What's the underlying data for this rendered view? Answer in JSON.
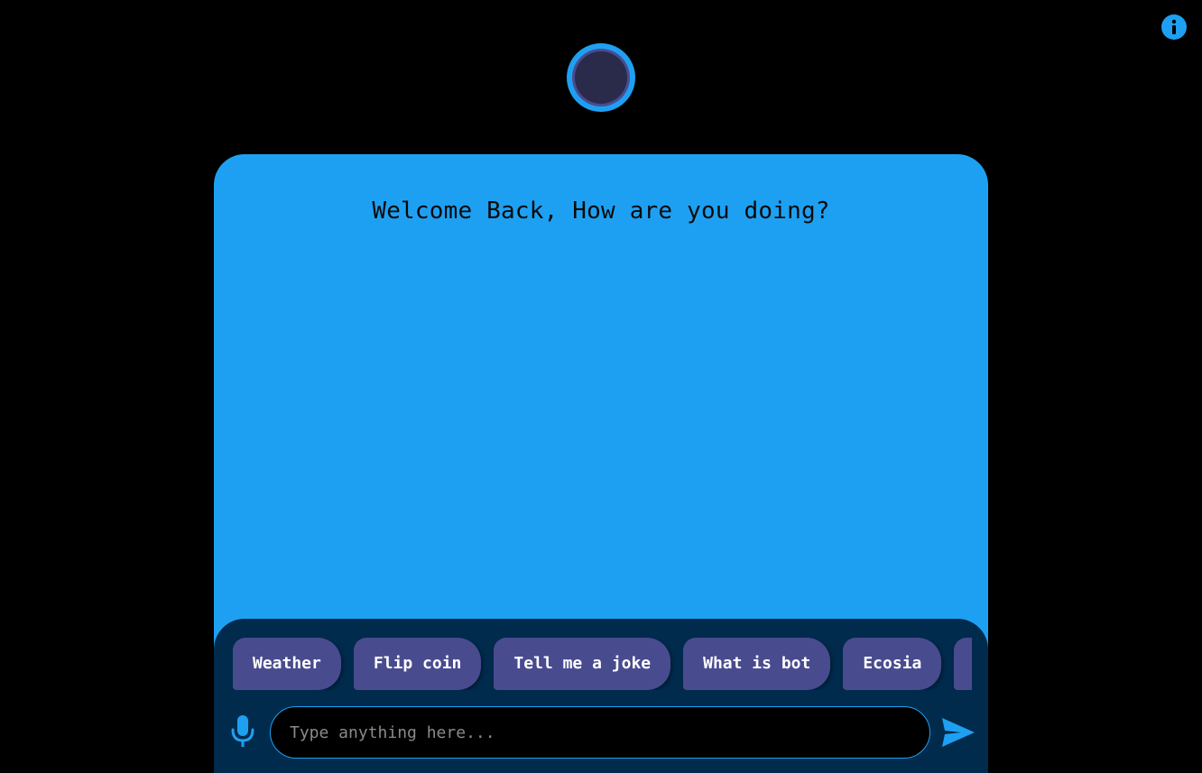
{
  "header": {
    "info_icon": "info-circle-icon",
    "avatar_icon": "ring-avatar-icon"
  },
  "chat": {
    "welcome_message": "Welcome Back, How are you doing?"
  },
  "suggestions": [
    {
      "label": "Weather"
    },
    {
      "label": "Flip coin"
    },
    {
      "label": "Tell me a joke"
    },
    {
      "label": "What is bot"
    },
    {
      "label": "Ecosia"
    },
    {
      "label": ""
    }
  ],
  "composer": {
    "mic_icon": "microphone-icon",
    "input_value": "",
    "input_placeholder": "Type anything here...",
    "send_icon": "send-icon"
  },
  "colors": {
    "background": "#000000",
    "chat_panel": "#1ea0f2",
    "bottom_panel": "#012b4d",
    "chip": "#494b8f",
    "accent": "#1ea0f2",
    "avatar_inner": "#2a2a4a",
    "avatar_ring_inner": "#494b8f"
  }
}
